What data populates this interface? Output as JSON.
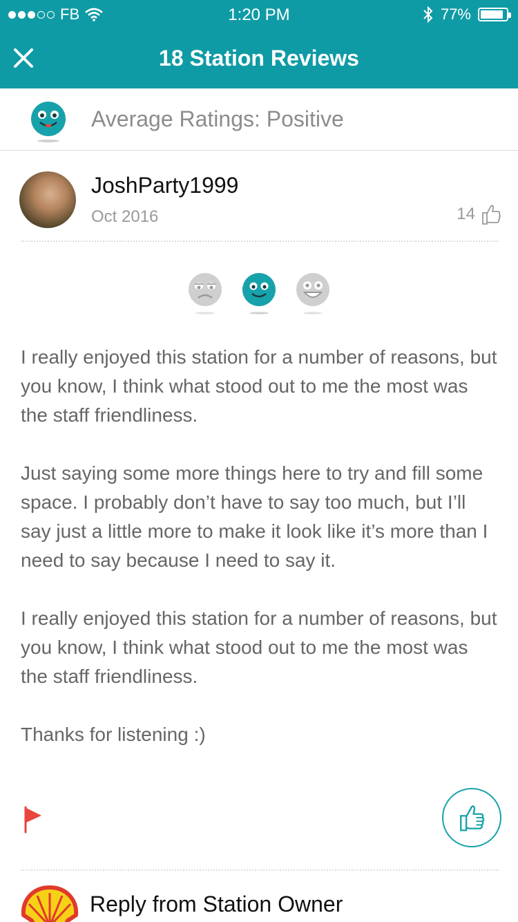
{
  "status_bar": {
    "carrier": "FB",
    "time": "1:20 PM",
    "battery": "77%"
  },
  "nav": {
    "title": "18 Station Reviews"
  },
  "summary": {
    "label": "Average Ratings: Positive",
    "icon": "positive-face-icon"
  },
  "review": {
    "username": "JoshParty1999",
    "date": "Oct 2016",
    "like_count": "14",
    "selected_rating": "positive",
    "paragraphs": [
      "I really enjoyed this station for a number of reasons, but you know, I think what stood out to me the most was the staff friendliness.",
      "Just saying some more things here to try and fill some space.  I probably don’t have to say too much, but I’ll say just a little more to make it look like it’s more than I need to say because I need to say it.",
      "I really enjoyed this station for a number of reasons, but you know, I think what stood out to me the most was the staff friendliness.",
      "Thanks for listening :)"
    ]
  },
  "reply": {
    "title": "Reply from Station Owner"
  },
  "colors": {
    "brand": "#0f9ba5",
    "flag": "#e8453c"
  }
}
